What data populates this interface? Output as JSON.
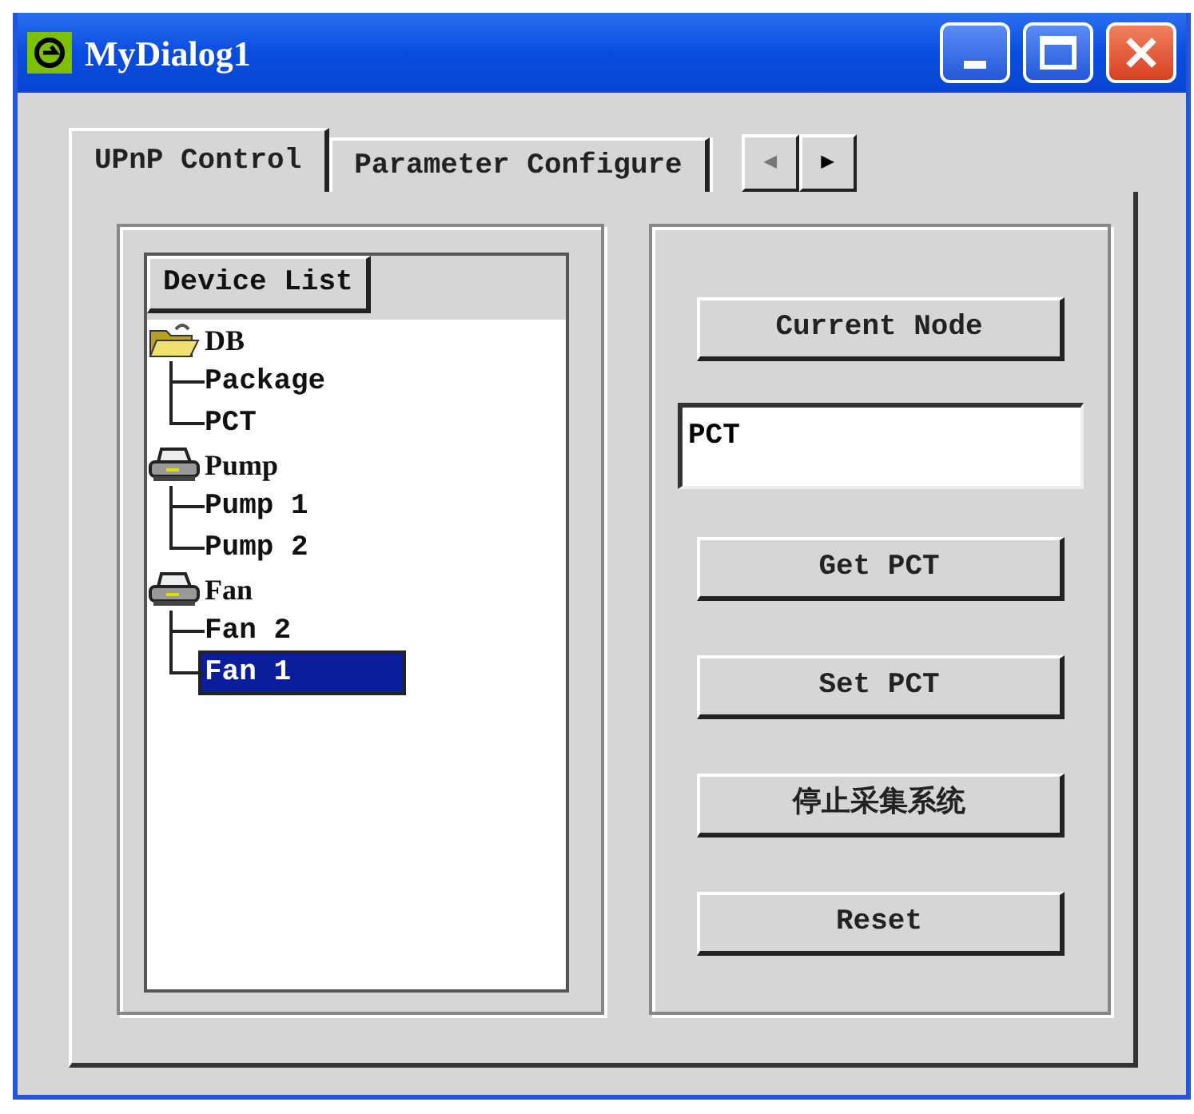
{
  "window": {
    "title": "MyDialog1"
  },
  "tabs": [
    {
      "label": "UPnP Control",
      "selected": true
    },
    {
      "label": "Parameter Configure",
      "selected": false
    }
  ],
  "tab_scroll": [
    {
      "glyph": "◀",
      "disabled": true
    },
    {
      "glyph": "▶",
      "disabled": false
    }
  ],
  "tree": {
    "header": "Device List",
    "items": [
      {
        "label": "DB",
        "kind": "folder",
        "selected": false,
        "children": [
          {
            "label": "Package",
            "selected": false
          },
          {
            "label": "PCT",
            "selected": false
          }
        ]
      },
      {
        "label": "Pump",
        "kind": "printer",
        "selected": false,
        "children": [
          {
            "label": "Pump 1",
            "selected": false
          },
          {
            "label": "Pump 2",
            "selected": false
          }
        ]
      },
      {
        "label": "Fan",
        "kind": "printer",
        "selected": false,
        "children": [
          {
            "label": "Fan 2",
            "selected": false
          },
          {
            "label": "Fan 1",
            "selected": true
          }
        ]
      }
    ]
  },
  "controls": [
    {
      "kind": "button",
      "label": "Current Node"
    },
    {
      "kind": "field",
      "value": "PCT"
    },
    {
      "kind": "button",
      "label": "Get PCT"
    },
    {
      "kind": "button",
      "label": "Set PCT"
    },
    {
      "kind": "button",
      "label": "停止采集系统"
    },
    {
      "kind": "button",
      "label": "Reset"
    }
  ]
}
